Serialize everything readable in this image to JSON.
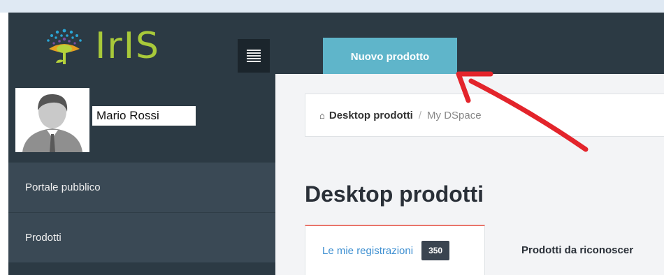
{
  "header": {
    "logo_text": "IrIS",
    "new_product_label": "Nuovo prodotto"
  },
  "user": {
    "name": "Mario Rossi"
  },
  "sidebar": {
    "items": [
      {
        "label": "Portale pubblico"
      },
      {
        "label": "Prodotti"
      }
    ]
  },
  "breadcrumb": {
    "home": "Desktop prodotti",
    "separator": "/",
    "current": "My DSpace"
  },
  "page": {
    "title": "Desktop prodotti"
  },
  "tabs": [
    {
      "label": "Le mie registrazioni",
      "count": "350",
      "active": true
    },
    {
      "label": "Prodotti da riconoscer"
    }
  ],
  "colors": {
    "topbar": "#2c3a44",
    "button": "#5fb5ca",
    "logo_green": "#a8c93a",
    "active_tab_border": "#e9746a",
    "link_blue": "#3d8fd1",
    "annotation_arrow": "#e3242b"
  }
}
